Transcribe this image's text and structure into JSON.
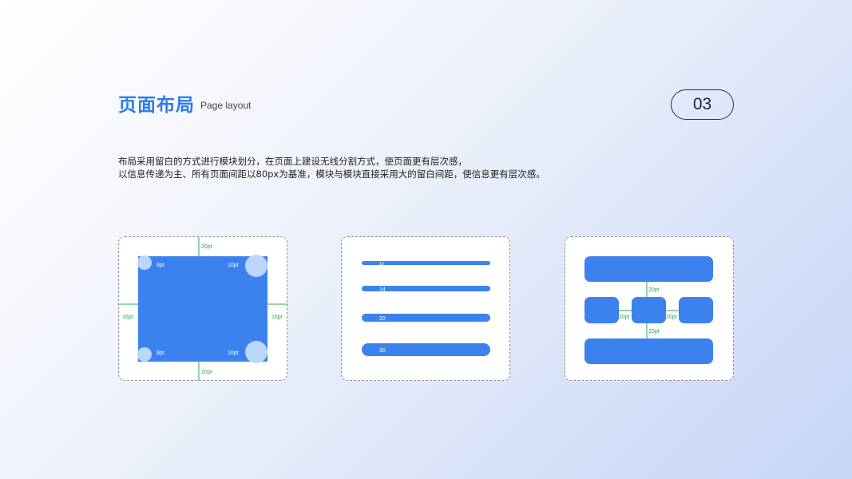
{
  "header": {
    "title": "页面布局",
    "subtitle": "Page layout",
    "page_number": "03"
  },
  "description": {
    "line1": "布局采用留白的方式进行模块划分，在页面上建设无线分割方式，使页面更有层次感，",
    "line2": "以信息传递为主、所有页面间距以80px为基准，模块与模块直接采用大的留白间距，使信息更有层次感。"
  },
  "card1": {
    "top_margin": "20pt",
    "bottom_margin": "20pt",
    "left_margin": "16pt",
    "right_margin": "16pt",
    "radius_top_left": "8pt",
    "radius_top_right": "10pt",
    "radius_bottom_left": "8pt",
    "radius_bottom_right": "10pt"
  },
  "card2": {
    "bars": [
      "10",
      "14",
      "20",
      "30"
    ]
  },
  "card3": {
    "gap_top": "20pt",
    "gap_left": "20pt",
    "gap_right": "20pt",
    "gap_bottom": "20pt"
  },
  "colors": {
    "accent": "#3b82ee",
    "light_circle": "#bcd6fb",
    "guide_green": "#2aa84a",
    "title_blue": "#2f7be8"
  }
}
